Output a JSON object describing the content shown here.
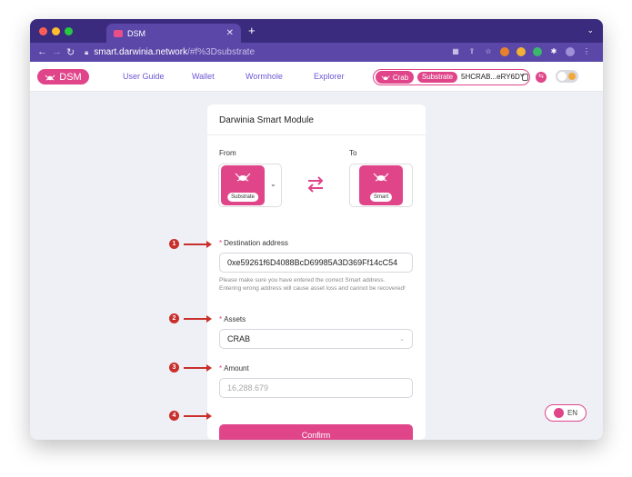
{
  "browser": {
    "tab_title": "DSM",
    "url_host": "smart.darwinia.network",
    "url_path": "/#f%3Dsubstrate"
  },
  "app": {
    "logo_label": "DSM",
    "nav": [
      "User Guide",
      "Wallet",
      "Wormhole",
      "Explorer"
    ],
    "network_label": "Crab",
    "account_type": "Substrate",
    "account_address": "5HCRAB...eRY6DY",
    "lang_label": "EN"
  },
  "card": {
    "title": "Darwinia Smart Module",
    "from_label": "From",
    "to_label": "To",
    "from_chain": "Substrate",
    "to_chain": "Smart",
    "destination_label": "Destination address",
    "destination_value": "0xe59261f6D4088BcD69985A3D369Ff14cC54",
    "hint": "Please make sure you have entered the correct Smart address. Entering wrong address will cause asset loss and cannot be recovered!",
    "assets_label": "Assets",
    "assets_value": "CRAB",
    "amount_label": "Amount",
    "amount_placeholder": "16,288.679",
    "confirm_label": "Confirm",
    "required_mark": "*"
  },
  "annotations": [
    "1",
    "2",
    "3",
    "4"
  ],
  "colors": {
    "accent": "#e0458a",
    "browser_chrome": "#3a2b7e",
    "annotation": "#c9302c"
  }
}
